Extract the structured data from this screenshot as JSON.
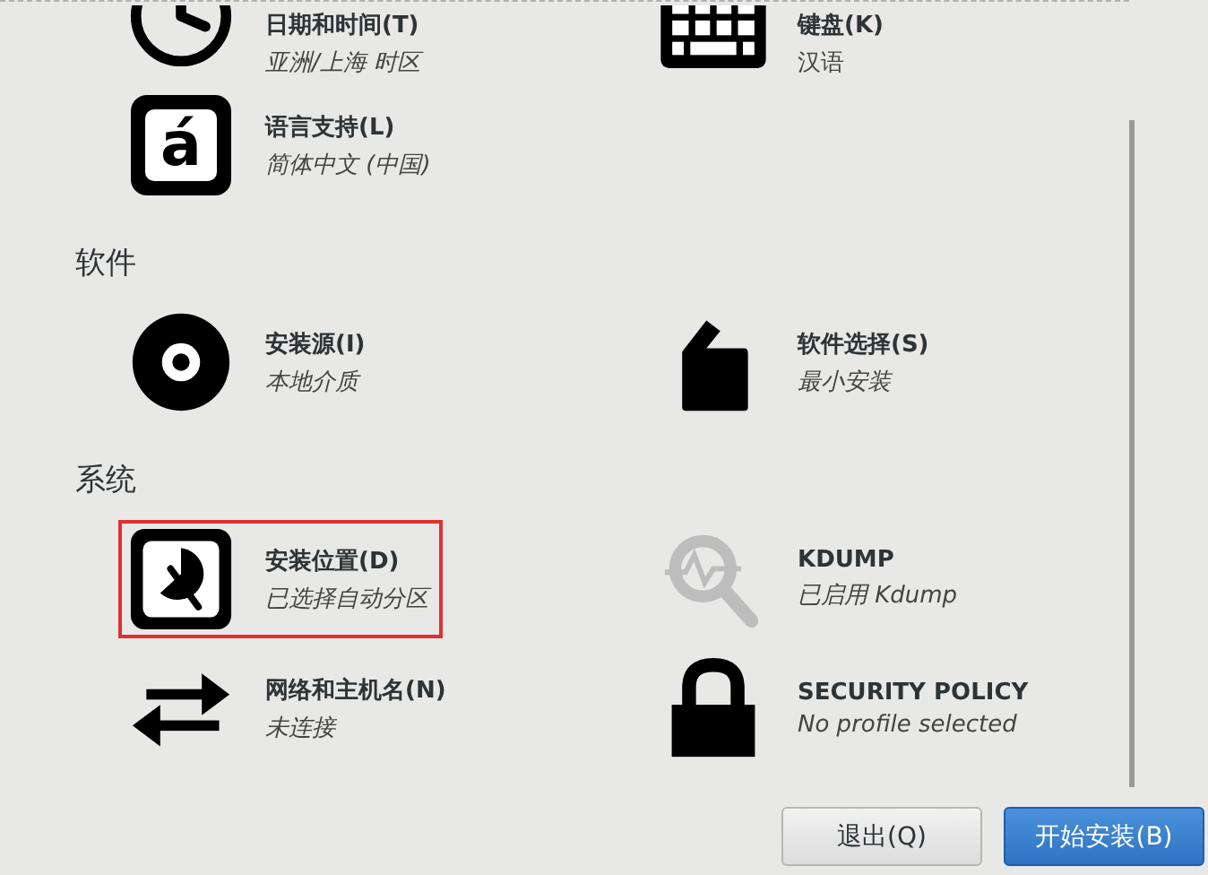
{
  "sections": [
    {
      "items": [
        {
          "kind": "clock",
          "title": "日期和时间(T)",
          "status": "亚洲/上海 时区",
          "italic": true,
          "selected": false
        },
        {
          "kind": "keyboard",
          "title": "键盘(K)",
          "status": "汉语",
          "italic": false,
          "selected": false
        },
        {
          "kind": "language",
          "icon_text": "á",
          "title": "语言支持(L)",
          "status": "简体中文 (中国)",
          "italic": true,
          "selected": false
        }
      ]
    },
    {
      "heading": "软件",
      "items": [
        {
          "kind": "disc",
          "title": "安装源(I)",
          "status": "本地介质",
          "italic": true,
          "selected": false
        },
        {
          "kind": "package",
          "title": "软件选择(S)",
          "status": "最小安装",
          "italic": true,
          "selected": false
        }
      ]
    },
    {
      "heading": "系统",
      "items": [
        {
          "kind": "disk",
          "title": "安装位置(D)",
          "status": "已选择自动分区",
          "italic": true,
          "selected": true
        },
        {
          "kind": "kdump",
          "title": "KDUMP",
          "status": "已启用 Kdump",
          "italic": true,
          "selected": false
        },
        {
          "kind": "network",
          "title": "网络和主机名(N)",
          "status": "未连接",
          "italic": true,
          "selected": false
        },
        {
          "kind": "lock",
          "title": "SECURITY POLICY",
          "status": "No profile selected",
          "italic": true,
          "selected": false
        }
      ]
    }
  ],
  "buttons": [
    {
      "label": "退出(Q)",
      "kind": "secondary"
    },
    {
      "label": "开始安装(B)",
      "kind": "primary"
    }
  ]
}
